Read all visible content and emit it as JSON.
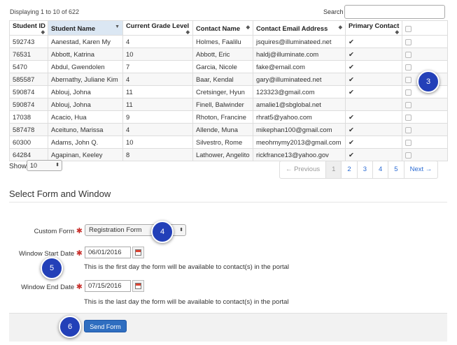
{
  "header": {
    "displaying": "Displaying 1 to 10 of 622",
    "search_label": "Search",
    "search_value": ""
  },
  "table": {
    "columns": [
      "Student ID",
      "Student Name",
      "Current Grade Level",
      "Contact Name",
      "Contact Email Address",
      "Primary Contact",
      ""
    ],
    "rows": [
      {
        "id": "592743",
        "name": "Aanestad, Karen My",
        "grade": "4",
        "contact": "Holmes, Faalilu",
        "email": "jsquires@illuminateed.net",
        "primary": "✔"
      },
      {
        "id": "76531",
        "name": "Abbott, Katrina",
        "grade": "10",
        "contact": "Abbott, Eric",
        "email": "haldj@illuminate.com",
        "primary": "✔"
      },
      {
        "id": "5470",
        "name": "Abdul, Gwendolen",
        "grade": "7",
        "contact": "Garcia, Nicole",
        "email": "fake@email.com",
        "primary": "✔"
      },
      {
        "id": "585587",
        "name": "Abernathy, Juliane Kim",
        "grade": "4",
        "contact": "Baar, Kendal",
        "email": "gary@illuminateed.net",
        "primary": "✔"
      },
      {
        "id": "590874",
        "name": "Ablouj, Johna",
        "grade": "11",
        "contact": "Cretsinger, Hyun",
        "email": "123323@gmail.com",
        "primary": "✔"
      },
      {
        "id": "590874",
        "name": "Ablouj, Johna",
        "grade": "11",
        "contact": "Finell, Balwinder",
        "email": "amalie1@sbglobal.net",
        "primary": ""
      },
      {
        "id": "17038",
        "name": "Acacio, Hua",
        "grade": "9",
        "contact": "Rhoton, Francine",
        "email": "rhrat5@yahoo.com",
        "primary": "✔"
      },
      {
        "id": "587478",
        "name": "Aceituno, Marissa",
        "grade": "4",
        "contact": "Allende, Muna",
        "email": "mikephan100@gmail.com",
        "primary": "✔"
      },
      {
        "id": "60300",
        "name": "Adams, John Q.",
        "grade": "10",
        "contact": "Silvestro, Rome",
        "email": "meohmymy2013@gmail.com",
        "primary": "✔"
      },
      {
        "id": "64284",
        "name": "Agapinan, Keeley",
        "grade": "8",
        "contact": "Lathower, Angelito",
        "email": "rickfrance13@yahoo.gov",
        "primary": "✔"
      }
    ]
  },
  "pagination": {
    "show_label": "Show",
    "page_size": "10",
    "previous": "← Previous",
    "pages": [
      "1",
      "2",
      "3",
      "4",
      "5"
    ],
    "next": "Next →"
  },
  "form": {
    "section_title": "Select Form and Window",
    "custom_form_label": "Custom Form",
    "custom_form_value": "Registration Form",
    "start_label": "Window Start Date",
    "start_value": "06/01/2016",
    "start_help": "This is the first day the form will be available to contact(s) in the portal",
    "end_label": "Window End Date",
    "end_value": "07/15/2016",
    "end_help": "This is the last day the form will be available to contact(s) in the portal",
    "required_mark": "✱",
    "send_label": "Send Form"
  },
  "callouts": [
    "3",
    "4",
    "5",
    "6"
  ]
}
